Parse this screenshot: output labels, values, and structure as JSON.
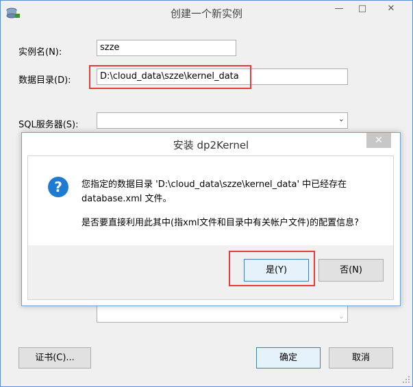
{
  "window": {
    "title": "创建一个新实例",
    "controls": {
      "minimize": "—",
      "maximize": "□",
      "close": "✕"
    }
  },
  "form": {
    "instance_name_label": "实例名(N):",
    "instance_name_value": "szze",
    "data_dir_label": "数据目录(D):",
    "data_dir_value": "D:\\cloud_data\\szze\\kernel_data",
    "sql_server_label": "SQL服务器(S):",
    "sql_server_value": ""
  },
  "buttons": {
    "cert": "证书(C)...",
    "ok": "确定",
    "cancel": "取消"
  },
  "dialog": {
    "title": "安装 dp2Kernel",
    "close": "✕",
    "line1": "您指定的数据目录 'D:\\cloud_data\\szze\\kernel_data' 中已经存在",
    "line2": "database.xml 文件。",
    "line3": "是否要直接利用此其中(指xml文件和目录中有关帐户文件)的配置信息?",
    "yes": "是(Y)",
    "no": "否(N)"
  },
  "colors": {
    "highlight": "#e53a3a",
    "accent": "#3c7fb1",
    "question_icon": "#1f7bd1"
  }
}
